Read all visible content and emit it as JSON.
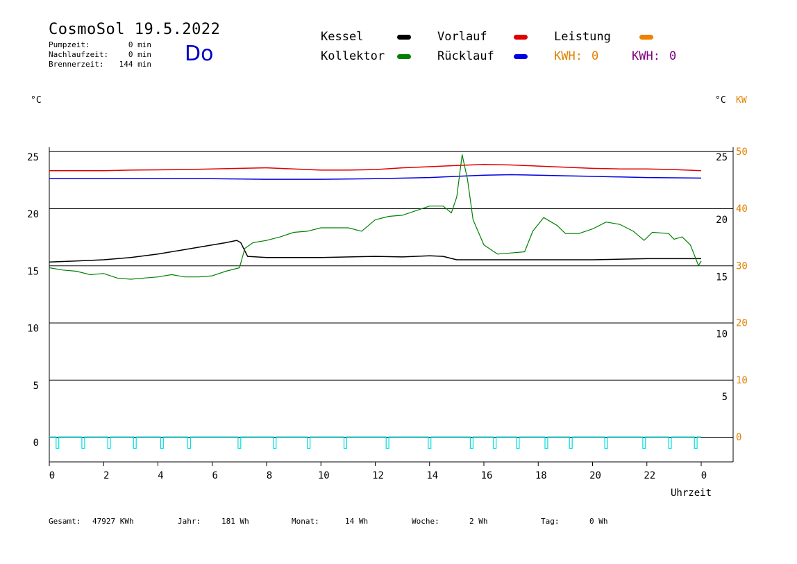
{
  "header": {
    "title": "CosmoSol 19.5.2022",
    "stats": [
      {
        "label": "Pumpzeit:",
        "value": "0 min"
      },
      {
        "label": "Nachlaufzeit:",
        "value": "0 min"
      },
      {
        "label": "Brennerzeit:",
        "value": "144 min"
      }
    ],
    "day": "Do"
  },
  "legend": {
    "kessel": {
      "label": "Kessel",
      "color": "#000000"
    },
    "kollektor": {
      "label": "Kollektor",
      "color": "#008000"
    },
    "vorlauf": {
      "label": "Vorlauf",
      "color": "#e00000"
    },
    "ruecklauf": {
      "label": "Rücklauf",
      "color": "#0000e0"
    },
    "leistung": {
      "label": "Leistung",
      "color": "#f08000"
    },
    "kwh_orange": {
      "label": "KWH:",
      "value": "0",
      "color": "#e08000"
    },
    "kwh_purple": {
      "label": "KWH:",
      "value": "0",
      "color": "#800080"
    }
  },
  "axes": {
    "left_unit": "°C",
    "right_unit": "°C",
    "right_unit2": "KW",
    "x_label": "Uhrzeit"
  },
  "footer": {
    "gesamt": {
      "label": "Gesamt:",
      "value": "47927 KWh"
    },
    "jahr": {
      "label": "Jahr:",
      "value": "181 Wh"
    },
    "monat": {
      "label": "Monat:",
      "value": "14 Wh"
    },
    "woche": {
      "label": "Woche:",
      "value": "2 Wh"
    },
    "tag": {
      "label": "Tag:",
      "value": "0 Wh"
    }
  },
  "chart_data": {
    "type": "line",
    "title": "CosmoSol 19.5.2022",
    "xlabel": "Uhrzeit",
    "ylabel": "°C",
    "xlim": [
      0,
      24
    ],
    "ylim": [
      -2,
      26
    ],
    "grid": true,
    "x_ticks": [
      "0",
      "2",
      "4",
      "6",
      "8",
      "10",
      "12",
      "14",
      "16",
      "18",
      "20",
      "22",
      "0"
    ],
    "y_left_ticks": [
      "25",
      "20",
      "15",
      "10",
      "5",
      "0"
    ],
    "y_right_inner_ticks": [
      {
        "value": 25,
        "label": "25"
      },
      {
        "value": 19.5,
        "label": "20"
      },
      {
        "value": 14.5,
        "label": "15"
      },
      {
        "value": 9.5,
        "label": "10"
      },
      {
        "value": 4,
        "label": "5"
      }
    ],
    "y_right_kw_ticks": [
      {
        "value": 25,
        "label": "50"
      },
      {
        "value": 20,
        "label": "40"
      },
      {
        "value": 15,
        "label": "30"
      },
      {
        "value": 10,
        "label": "20"
      },
      {
        "value": 5,
        "label": "10"
      },
      {
        "value": 0,
        "label": "0"
      }
    ],
    "series": [
      {
        "name": "Vorlauf",
        "color": "#e00000",
        "points": [
          [
            0,
            23.3
          ],
          [
            2,
            23.3
          ],
          [
            3,
            23.35
          ],
          [
            5,
            23.4
          ],
          [
            6,
            23.45
          ],
          [
            7,
            23.5
          ],
          [
            8,
            23.55
          ],
          [
            9,
            23.45
          ],
          [
            10,
            23.35
          ],
          [
            11,
            23.35
          ],
          [
            12,
            23.4
          ],
          [
            13,
            23.55
          ],
          [
            14,
            23.65
          ],
          [
            15,
            23.75
          ],
          [
            16,
            23.85
          ],
          [
            17,
            23.8
          ],
          [
            18,
            23.7
          ],
          [
            19,
            23.6
          ],
          [
            20,
            23.5
          ],
          [
            21,
            23.45
          ],
          [
            22,
            23.45
          ],
          [
            23,
            23.4
          ],
          [
            24,
            23.3
          ]
        ]
      },
      {
        "name": "Rücklauf",
        "color": "#0000e0",
        "points": [
          [
            0,
            22.6
          ],
          [
            3,
            22.6
          ],
          [
            6,
            22.6
          ],
          [
            8,
            22.55
          ],
          [
            10,
            22.55
          ],
          [
            12,
            22.6
          ],
          [
            14,
            22.7
          ],
          [
            15,
            22.8
          ],
          [
            16,
            22.9
          ],
          [
            17,
            22.95
          ],
          [
            18,
            22.9
          ],
          [
            19,
            22.85
          ],
          [
            20,
            22.8
          ],
          [
            22,
            22.7
          ],
          [
            24,
            22.65
          ]
        ]
      },
      {
        "name": "Kessel",
        "color": "#000000",
        "points": [
          [
            0,
            15.3
          ],
          [
            1,
            15.4
          ],
          [
            2,
            15.5
          ],
          [
            3,
            15.7
          ],
          [
            4,
            16.0
          ],
          [
            5,
            16.4
          ],
          [
            6,
            16.8
          ],
          [
            6.5,
            17.0
          ],
          [
            6.9,
            17.2
          ],
          [
            7.05,
            17.0
          ],
          [
            7.3,
            15.8
          ],
          [
            8,
            15.7
          ],
          [
            10,
            15.7
          ],
          [
            12,
            15.8
          ],
          [
            13,
            15.75
          ],
          [
            14,
            15.85
          ],
          [
            14.5,
            15.8
          ],
          [
            15,
            15.5
          ],
          [
            16,
            15.5
          ],
          [
            18,
            15.5
          ],
          [
            20,
            15.5
          ],
          [
            22,
            15.6
          ],
          [
            24,
            15.6
          ]
        ]
      },
      {
        "name": "Kollektor",
        "color": "#008000",
        "points": [
          [
            0,
            14.8
          ],
          [
            0.5,
            14.6
          ],
          [
            1,
            14.5
          ],
          [
            1.5,
            14.2
          ],
          [
            2,
            14.3
          ],
          [
            2.5,
            13.9
          ],
          [
            3,
            13.8
          ],
          [
            3.5,
            13.9
          ],
          [
            4,
            14.0
          ],
          [
            4.5,
            14.2
          ],
          [
            5,
            14.0
          ],
          [
            5.5,
            14.0
          ],
          [
            6,
            14.1
          ],
          [
            6.5,
            14.5
          ],
          [
            7,
            14.8
          ],
          [
            7.2,
            16.5
          ],
          [
            7.5,
            17.0
          ],
          [
            8,
            17.2
          ],
          [
            8.5,
            17.5
          ],
          [
            9,
            17.9
          ],
          [
            9.5,
            18.0
          ],
          [
            10,
            18.3
          ],
          [
            11,
            18.3
          ],
          [
            11.5,
            18.0
          ],
          [
            12,
            19.0
          ],
          [
            12.5,
            19.3
          ],
          [
            13,
            19.4
          ],
          [
            13.5,
            19.8
          ],
          [
            14,
            20.2
          ],
          [
            14.5,
            20.2
          ],
          [
            14.8,
            19.6
          ],
          [
            15,
            21.0
          ],
          [
            15.2,
            24.7
          ],
          [
            15.4,
            22.5
          ],
          [
            15.6,
            19.0
          ],
          [
            16,
            16.8
          ],
          [
            16.5,
            16.0
          ],
          [
            17,
            16.1
          ],
          [
            17.5,
            16.2
          ],
          [
            17.8,
            18.0
          ],
          [
            18.2,
            19.2
          ],
          [
            18.7,
            18.5
          ],
          [
            19,
            17.8
          ],
          [
            19.5,
            17.8
          ],
          [
            20,
            18.2
          ],
          [
            20.5,
            18.8
          ],
          [
            21,
            18.6
          ],
          [
            21.5,
            18.0
          ],
          [
            21.9,
            17.2
          ],
          [
            22.2,
            17.9
          ],
          [
            22.8,
            17.8
          ],
          [
            23,
            17.3
          ],
          [
            23.3,
            17.5
          ],
          [
            23.6,
            16.8
          ],
          [
            23.9,
            15.0
          ],
          [
            24,
            15.4
          ]
        ]
      }
    ],
    "pulse_series": {
      "name": "Leistung",
      "color": "#00dede",
      "baseline": 0,
      "low": -1,
      "pulses": [
        [
          0.25,
          0.35
        ],
        [
          1.2,
          1.3
        ],
        [
          2.15,
          2.25
        ],
        [
          3.1,
          3.2
        ],
        [
          4.1,
          4.2
        ],
        [
          5.1,
          5.2
        ],
        [
          6.95,
          7.05
        ],
        [
          8.25,
          8.35
        ],
        [
          9.5,
          9.6
        ],
        [
          10.85,
          10.95
        ],
        [
          12.4,
          12.5
        ],
        [
          13.95,
          14.05
        ],
        [
          15.5,
          15.6
        ],
        [
          16.35,
          16.45
        ],
        [
          17.2,
          17.3
        ],
        [
          18.25,
          18.35
        ],
        [
          19.15,
          19.25
        ],
        [
          20.45,
          20.55
        ],
        [
          21.85,
          21.95
        ],
        [
          22.8,
          22.9
        ],
        [
          23.75,
          23.85
        ]
      ]
    }
  }
}
